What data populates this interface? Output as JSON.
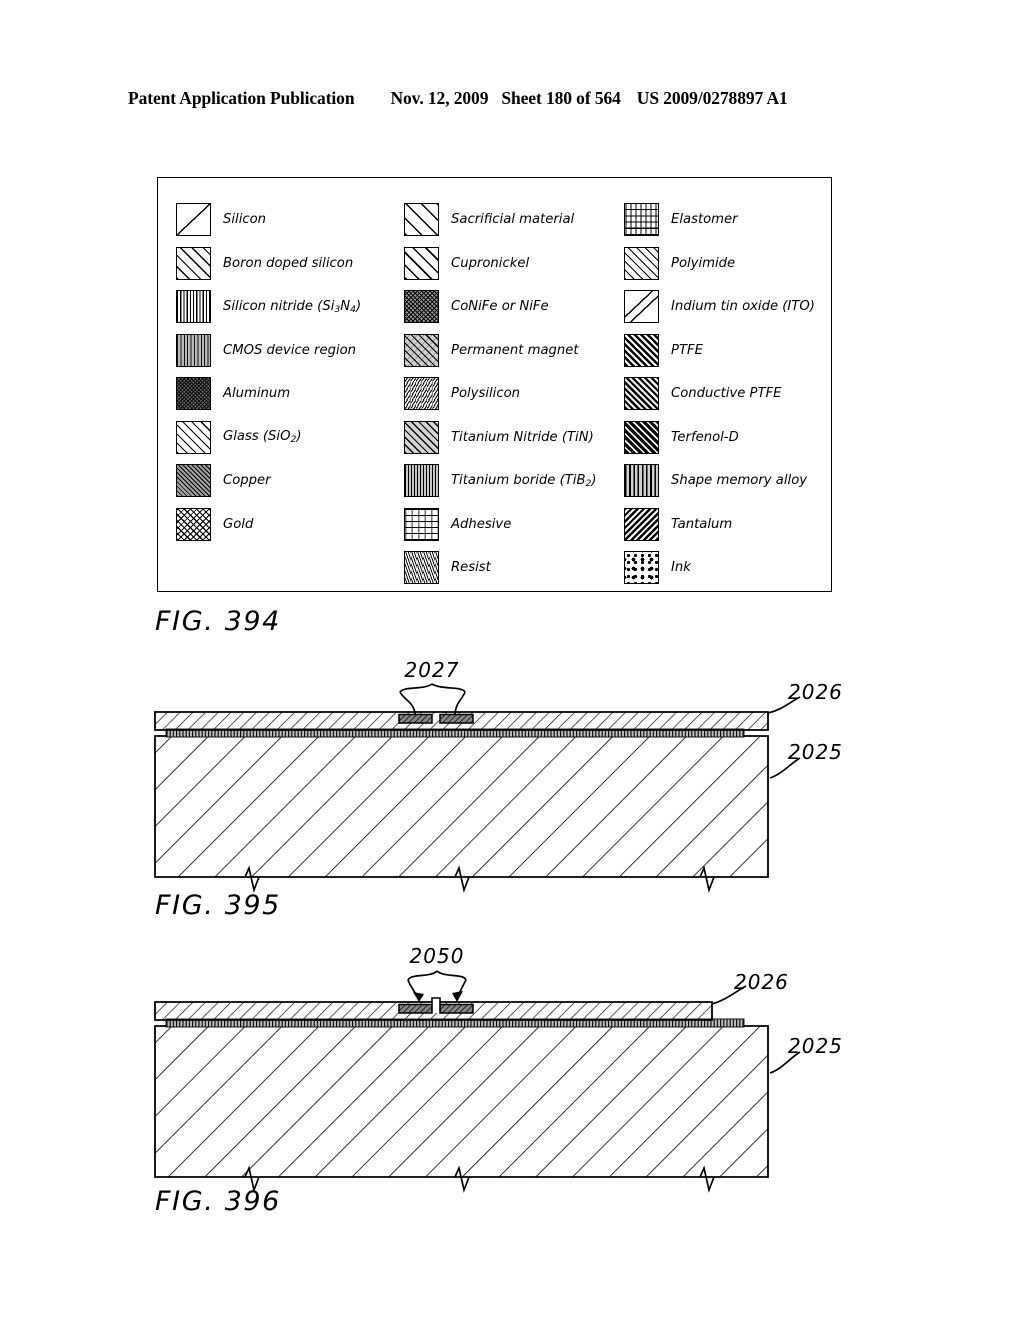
{
  "header": {
    "publication": "Patent Application Publication",
    "date": "Nov. 12, 2009",
    "sheet": "Sheet 180 of 564",
    "patent_number": "US 2009/0278897 A1"
  },
  "legend": {
    "figure_label": "FIG. 394",
    "columns": [
      {
        "items": [
          {
            "label": "Silicon",
            "pattern": "p-silicon"
          },
          {
            "label": "Boron doped silicon",
            "pattern": "p-boron"
          },
          {
            "label": "Silicon nitride (Si3N4)",
            "pattern": "p-sinitride",
            "rich": "Silicon nitride (Si<sub>3</sub>N<sub>4</sub>)"
          },
          {
            "label": "CMOS device region",
            "pattern": "p-cmos"
          },
          {
            "label": "Aluminum",
            "pattern": "p-aluminum"
          },
          {
            "label": "Glass (SiO2)",
            "pattern": "p-glass",
            "rich": "Glass (SiO<sub>2</sub>)"
          },
          {
            "label": "Copper",
            "pattern": "p-copper"
          },
          {
            "label": "Gold",
            "pattern": "p-gold"
          }
        ]
      },
      {
        "items": [
          {
            "label": "Sacrificial material",
            "pattern": "p-sacrificial"
          },
          {
            "label": "Cupronickel",
            "pattern": "p-cupronickel"
          },
          {
            "label": "CoNiFe or NiFe",
            "pattern": "p-conife"
          },
          {
            "label": "Permanent magnet",
            "pattern": "p-magnet"
          },
          {
            "label": "Polysilicon",
            "pattern": "p-polysilicon"
          },
          {
            "label": "Titanium Nitride (TiN)",
            "pattern": "p-tin"
          },
          {
            "label": "Titanium boride (TiB2)",
            "pattern": "p-tib2",
            "rich": "Titanium boride (TiB<sub>2</sub>)"
          },
          {
            "label": "Adhesive",
            "pattern": "p-adhesive"
          },
          {
            "label": "Resist",
            "pattern": "p-resist"
          }
        ]
      },
      {
        "items": [
          {
            "label": "Elastomer",
            "pattern": "p-elastomer"
          },
          {
            "label": "Polyimide",
            "pattern": "p-polyimide"
          },
          {
            "label": "Indium tin oxide (ITO)",
            "pattern": "p-ito"
          },
          {
            "label": "PTFE",
            "pattern": "p-ptfe"
          },
          {
            "label": "Conductive PTFE",
            "pattern": "p-cptfe"
          },
          {
            "label": "Terfenol-D",
            "pattern": "p-terfenol"
          },
          {
            "label": "Shape memory alloy",
            "pattern": "p-sma"
          },
          {
            "label": "Tantalum",
            "pattern": "p-tantalum"
          },
          {
            "label": "Ink",
            "pattern": "p-ink"
          }
        ]
      }
    ]
  },
  "figures": [
    {
      "id": "fig-395",
      "label": "FIG. 395",
      "callouts": {
        "top": "2027",
        "upper_right": "2026",
        "lower_right": "2025"
      }
    },
    {
      "id": "fig-396",
      "label": "FIG. 396",
      "callouts": {
        "top": "2050",
        "upper_right": "2026",
        "lower_right": "2025"
      }
    }
  ]
}
